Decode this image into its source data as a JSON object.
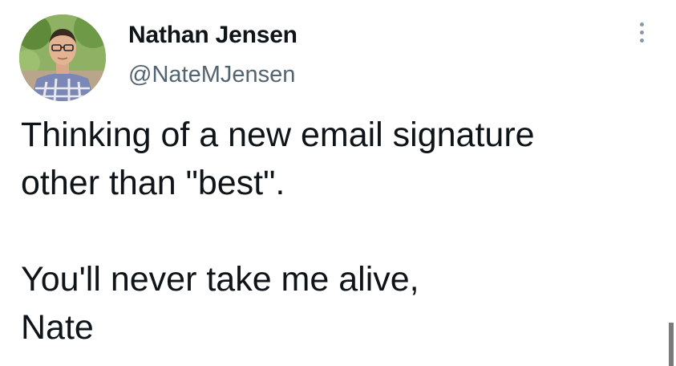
{
  "tweet": {
    "author": {
      "display_name": "Nathan Jensen",
      "handle": "@NateMJensen",
      "avatar_icon": "profile-photo"
    },
    "more_icon": "more-vertical-icon",
    "lines": [
      "Thinking of a new email signature",
      "other than \"best\".",
      "",
      "You'll never take me alive,",
      "Nate"
    ]
  },
  "colors": {
    "text_primary": "#0f1419",
    "text_secondary": "#536471",
    "icon_muted": "#8b98a5"
  }
}
